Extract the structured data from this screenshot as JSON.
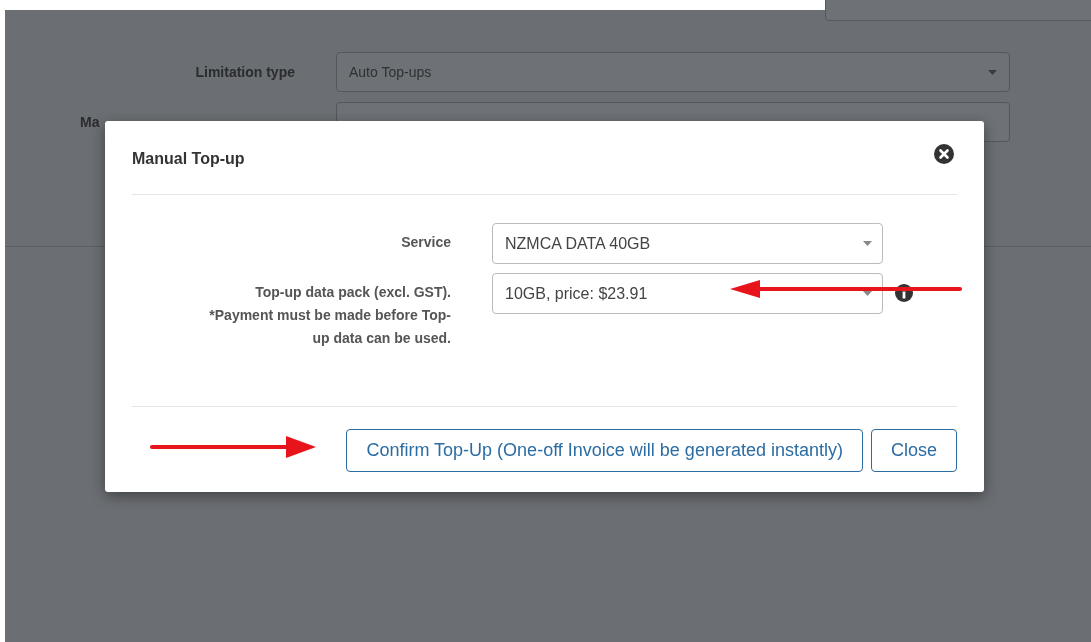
{
  "background": {
    "rows": [
      {
        "label": "Limitation type",
        "value": "Auto Top-ups",
        "kind": "select"
      },
      {
        "label": "Ma",
        "kind": "input"
      }
    ]
  },
  "modal": {
    "title": "Manual Top-up",
    "fields": [
      {
        "label": "Service",
        "value": "NZMCA DATA 40GB",
        "info": false
      },
      {
        "label": "Top-up data pack (excl. GST).\n*Payment must be made before Top-\nup data can be used.",
        "value": "10GB, price: $23.91",
        "info": true
      }
    ],
    "buttons": [
      {
        "label": "Confirm Top-Up (One-off Invoice will be generated instantly)"
      },
      {
        "label": "Close"
      }
    ]
  }
}
